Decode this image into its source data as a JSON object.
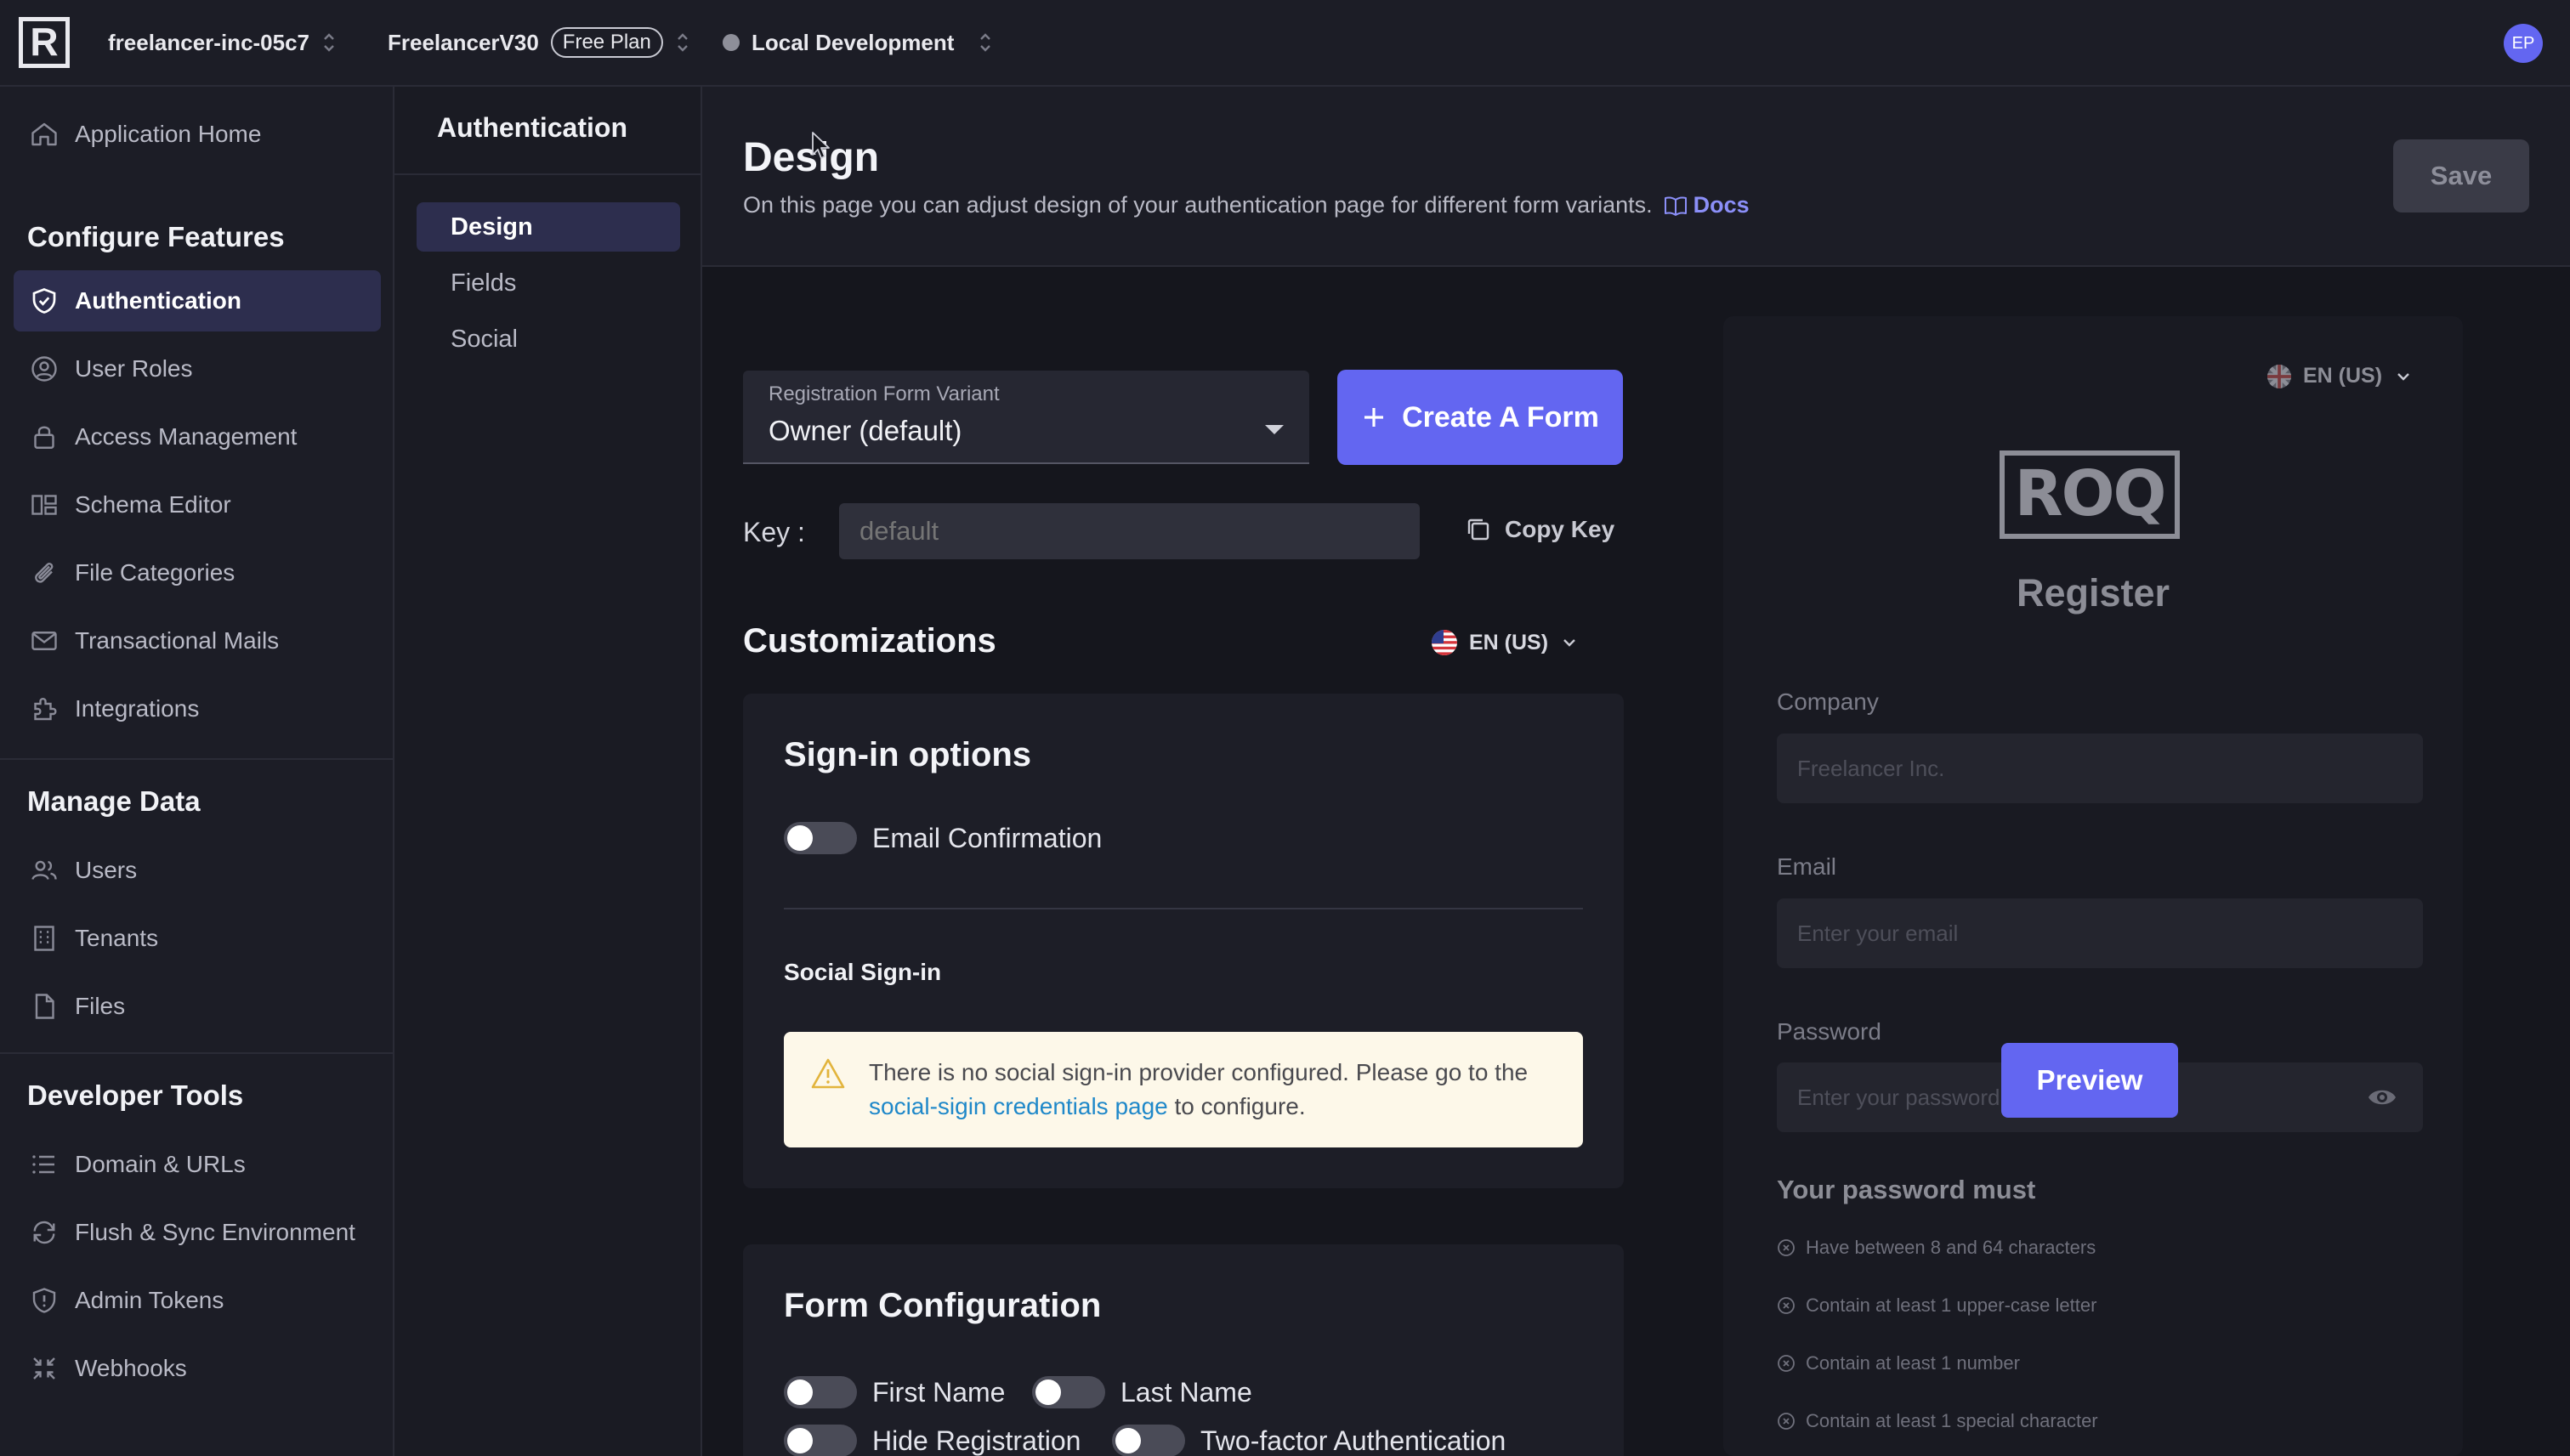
{
  "topbar": {
    "org": "freelancer-inc-05c7",
    "app": "FreelancerV30",
    "plan": "Free Plan",
    "env": "Local Development",
    "avatar_initials": "EP"
  },
  "sidebar": {
    "home": "Application Home",
    "section_configure": "Configure Features",
    "configure_items": [
      {
        "label": "Authentication",
        "icon": "shield-check-icon"
      },
      {
        "label": "User Roles",
        "icon": "user-circle-icon"
      },
      {
        "label": "Access Management",
        "icon": "lock-icon"
      },
      {
        "label": "Schema Editor",
        "icon": "schema-icon"
      },
      {
        "label": "File Categories",
        "icon": "paperclip-icon"
      },
      {
        "label": "Transactional Mails",
        "icon": "mail-icon"
      },
      {
        "label": "Integrations",
        "icon": "puzzle-icon"
      }
    ],
    "section_manage": "Manage Data",
    "manage_items": [
      {
        "label": "Users",
        "icon": "users-icon"
      },
      {
        "label": "Tenants",
        "icon": "building-icon"
      },
      {
        "label": "Files",
        "icon": "file-icon"
      }
    ],
    "section_dev": "Developer Tools",
    "dev_items": [
      {
        "label": "Domain & URLs",
        "icon": "list-icon"
      },
      {
        "label": "Flush & Sync Environment",
        "icon": "refresh-icon"
      },
      {
        "label": "Admin Tokens",
        "icon": "shield-alert-icon"
      },
      {
        "label": "Webhooks",
        "icon": "webhook-icon"
      }
    ]
  },
  "subnav": {
    "title": "Authentication",
    "items": [
      "Design",
      "Fields",
      "Social"
    ]
  },
  "header": {
    "title": "Design",
    "description": "On this page you can adjust design of your authentication page for different form variants.",
    "docs": "Docs",
    "save": "Save"
  },
  "form": {
    "variant_label": "Registration Form Variant",
    "variant_value": "Owner (default)",
    "create_button": "Create A Form",
    "key_label": "Key :",
    "key_placeholder": "default",
    "copy_key": "Copy Key",
    "customizations_title": "Customizations",
    "language": "EN (US)"
  },
  "signin_card": {
    "title": "Sign-in options",
    "email_confirmation": "Email Confirmation",
    "email_confirmation_on": false,
    "social_title": "Social Sign-in",
    "warning_before": "There is no social sign-in provider configured. Please go to the ",
    "warning_link": "social-sigin credentials page",
    "warning_after": " to configure."
  },
  "form_config_card": {
    "title": "Form Configuration",
    "toggles": [
      "First Name",
      "Last Name",
      "Hide Registration",
      "Two-factor Authentication"
    ]
  },
  "preview": {
    "language": "EN (US)",
    "logo_text": "ROQ",
    "title": "Register",
    "company_label": "Company",
    "company_value": "Freelancer Inc.",
    "email_label": "Email",
    "email_placeholder": "Enter your email",
    "password_label": "Password",
    "password_placeholder": "Enter your password",
    "preview_button": "Preview",
    "password_rules_title": "Your password must",
    "password_rules": [
      "Have between 8 and 64 characters",
      "Contain at least 1 upper-case letter",
      "Contain at least 1 number",
      "Contain at least 1 special character"
    ]
  },
  "colors": {
    "accent": "#6366f1",
    "background": "#15161d",
    "panel": "#1c1d26",
    "warning_bg": "#fdf8e9",
    "link": "#1f88c9"
  }
}
